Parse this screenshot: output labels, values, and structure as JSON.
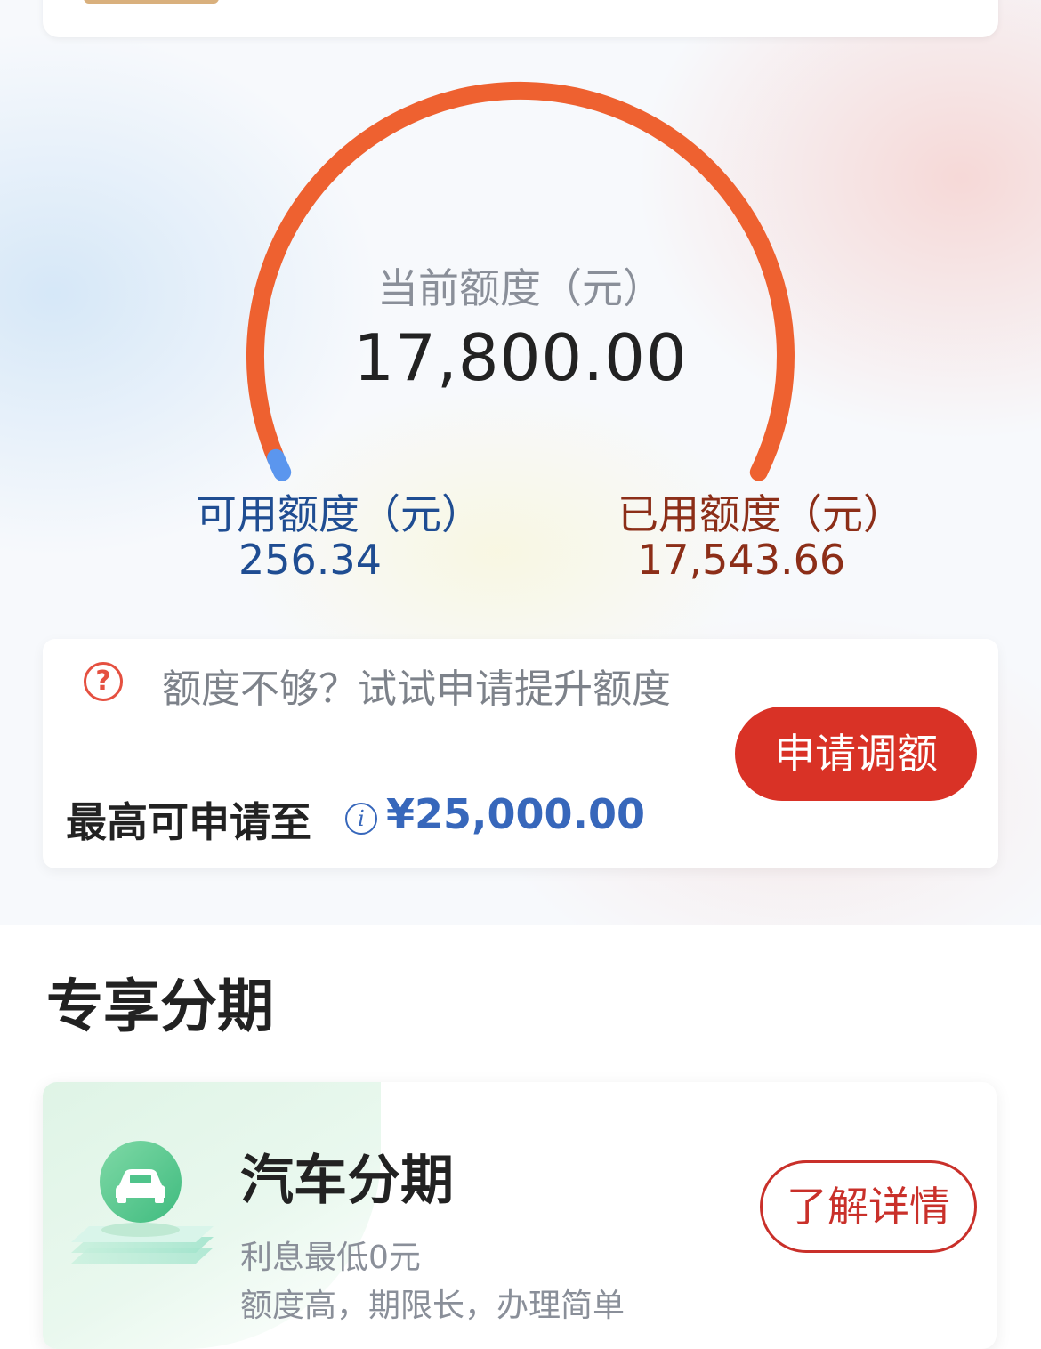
{
  "credit": {
    "current_label": "当前额度（元）",
    "current_value": "17,800.00",
    "available_label": "可用额度（元）",
    "available_value": "256.34",
    "used_label": "已用额度（元）",
    "used_value": "17,543.66",
    "available_fraction": 0.0144,
    "colors": {
      "used_arc": "#ee6130",
      "available_arc": "#5b96ee"
    }
  },
  "raise": {
    "prompt": "额度不够？试试申请提升额度",
    "max_label": "最高可申请至",
    "info_icon": "i",
    "max_value": "¥25,000.00",
    "button_label": "申请调额",
    "question_icon": "?"
  },
  "installments": {
    "section_title": "专享分期",
    "card": {
      "icon": "car-icon",
      "title": "汽车分期",
      "desc1": "利息最低0元",
      "desc2": "额度高，期限长，办理简单",
      "button_label": "了解详情"
    }
  }
}
